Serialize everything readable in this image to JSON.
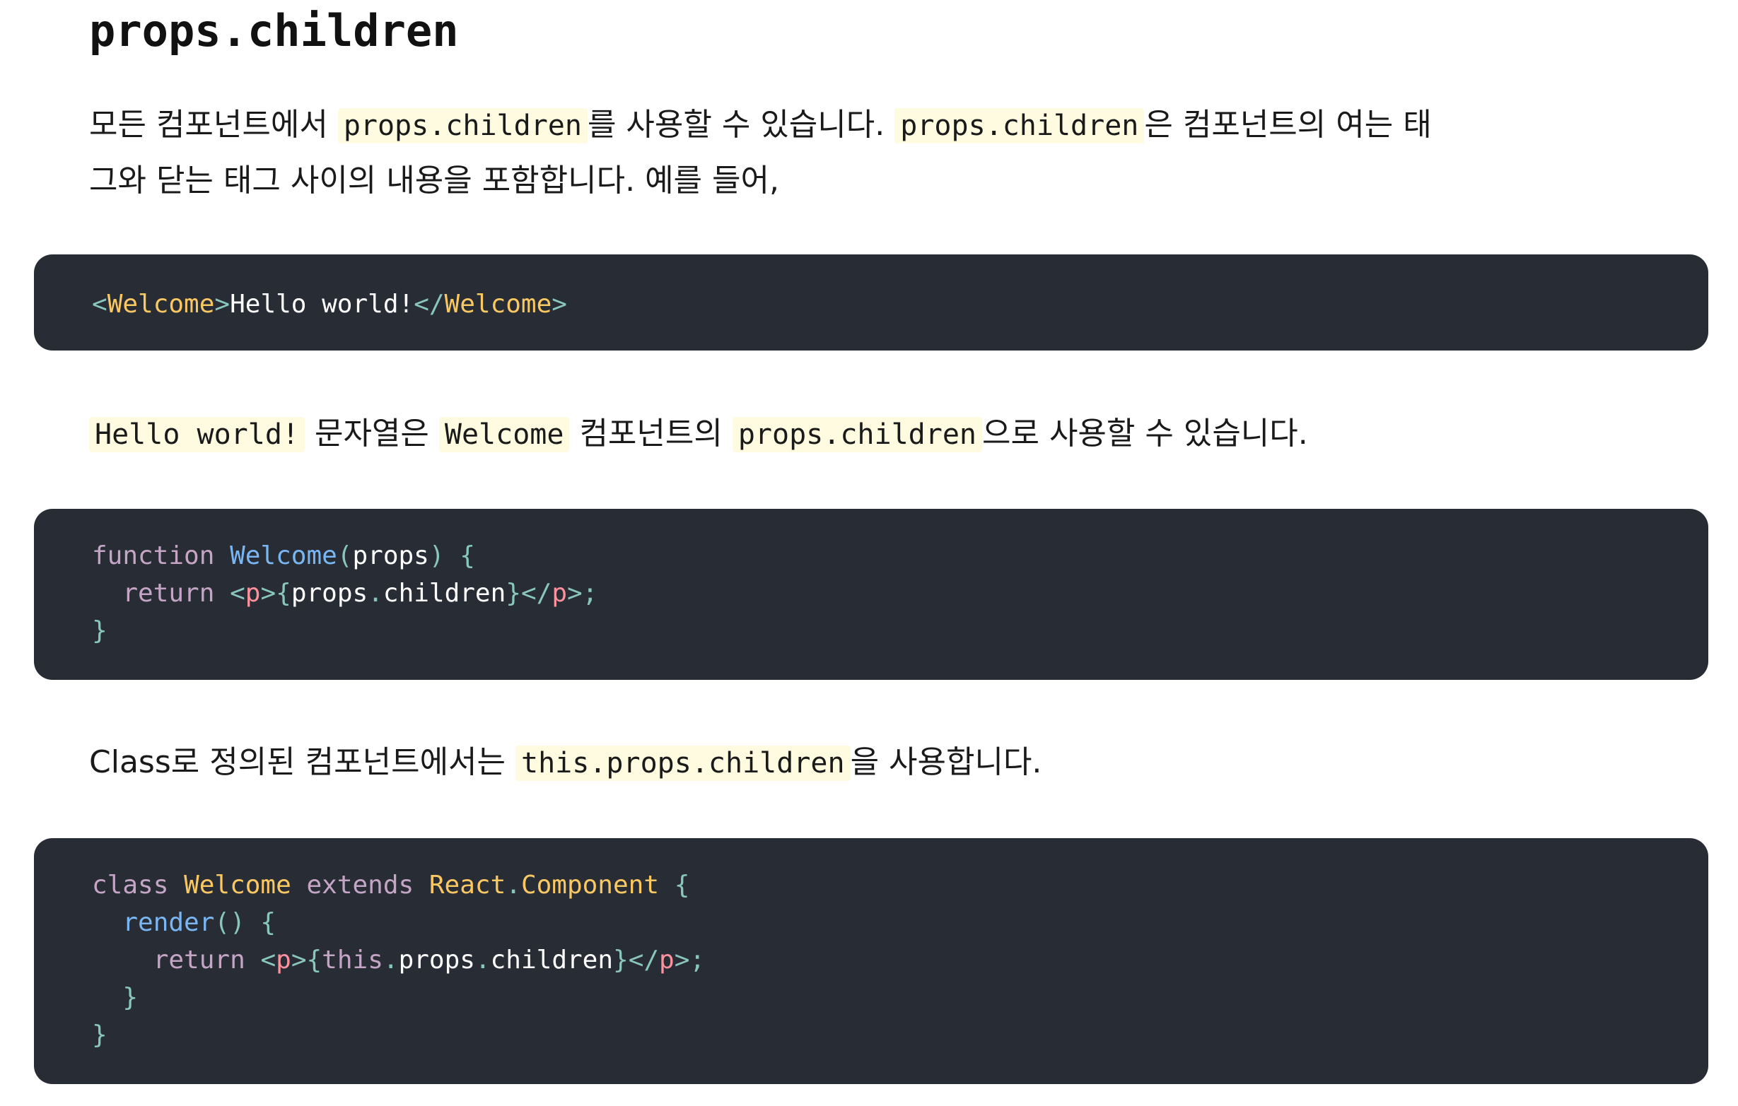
{
  "heading": "props.children",
  "para1": {
    "t1": "모든 컴포넌트에서 ",
    "code1": "props.children",
    "t2": "를 사용할 수 있습니다. ",
    "code2": "props.children",
    "t3": "은 컴포넌트의 여는 태그와 닫는 태그 사이의 내용을 포함합니다. 예를 들어,"
  },
  "code1": {
    "lt": "<",
    "tag_open": "Welcome",
    "gt": ">",
    "text": "Hello world!",
    "lt_slash": "</",
    "tag_close": "Welcome",
    "gt2": ">"
  },
  "para2": {
    "code1": "Hello world!",
    "t1": " 문자열은 ",
    "code2": "Welcome",
    "t2": " 컴포넌트의 ",
    "code3": "props.children",
    "t3": "으로 사용할 수 있습니다."
  },
  "code2": {
    "kw_function": "function",
    "fn_name": "Welcome",
    "paren_open": "(",
    "param": "props",
    "paren_close_brace": ") {",
    "kw_return": "return",
    "tag_lt": "<",
    "tag_p": "p",
    "tag_gt_brace": ">{",
    "expr_props": "props",
    "dot": ".",
    "expr_children": "children",
    "brace_close_lt": "}</",
    "tag_p2": "p",
    "gt_semi": ">;",
    "close_brace": "}"
  },
  "para3": {
    "t1": "Class로 정의된 컴포넌트에서는 ",
    "code1": "this.props.children",
    "t2": "을 사용합니다."
  },
  "code3": {
    "kw_class": "class",
    "class_name": "Welcome",
    "kw_extends": "extends",
    "base_react": "React",
    "dot1": ".",
    "base_component": "Component",
    "brace_open": "{",
    "method": "render",
    "method_parens": "() {",
    "kw_return": "return",
    "tag_lt": "<",
    "tag_p": "p",
    "tag_gt_brace": ">{",
    "kw_this": "this",
    "dot2": ".",
    "expr_props": "props",
    "dot3": ".",
    "expr_children": "children",
    "brace_close_lt": "}</",
    "tag_p2": "p",
    "gt_semi": ">;",
    "inner_close": "}",
    "outer_close": "}"
  }
}
